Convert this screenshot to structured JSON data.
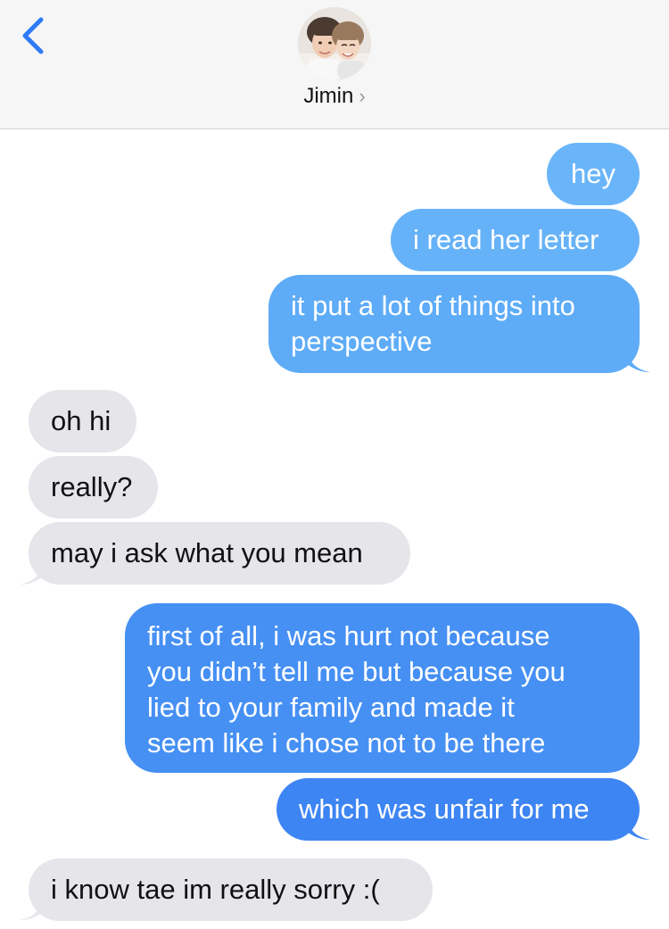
{
  "header": {
    "contact_name": "Jimin",
    "chevron": "›",
    "back_icon": "chevron-left-icon",
    "avatar": "contact-avatar-photo"
  },
  "colors": {
    "outgoing_top": "#6ab5f9",
    "outgoing_bottom": "#3b82f3",
    "incoming": "#e5e5ea",
    "accent": "#2f7bf6"
  },
  "messages": [
    {
      "from": "me",
      "text": "hey"
    },
    {
      "from": "me",
      "text": "i read her letter"
    },
    {
      "from": "me",
      "lines": [
        "it put a lot of things into",
        "perspective"
      ]
    },
    {
      "from": "them",
      "text": "oh hi"
    },
    {
      "from": "them",
      "text": "really?"
    },
    {
      "from": "them",
      "text": "may i ask what you mean"
    },
    {
      "from": "me",
      "lines": [
        "first of all, i was hurt not because",
        "you didn’t tell me but because you",
        "lied to your family and made it",
        "seem like i chose not to be there"
      ]
    },
    {
      "from": "me",
      "text": "which was unfair for me"
    },
    {
      "from": "them",
      "text": "i know tae im really sorry :("
    }
  ]
}
